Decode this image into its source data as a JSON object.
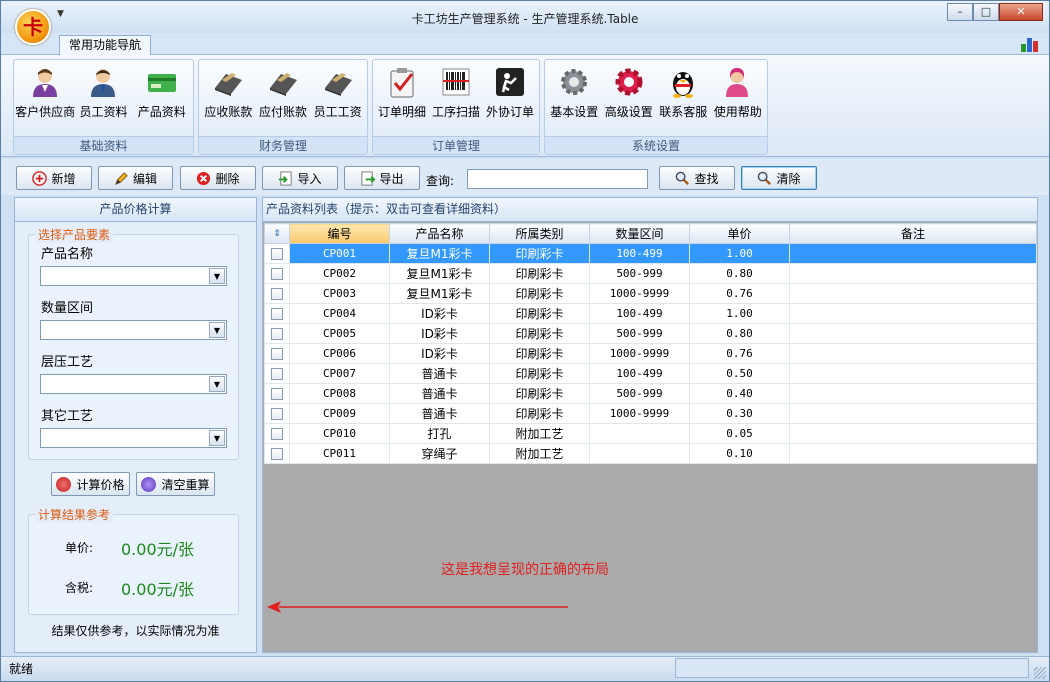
{
  "window": {
    "title": "卡工坊生产管理系统 - 生产管理系统.Table",
    "logo_char": "卡",
    "controls": {
      "minimize": "–",
      "maximize": "□",
      "close": "✕"
    }
  },
  "tabs": [
    {
      "label": "常用功能导航",
      "selected": true
    }
  ],
  "ribbon": {
    "groups": [
      {
        "label": "基础资料",
        "buttons": [
          {
            "label": "客户供应商",
            "icon": "customer-icon"
          },
          {
            "label": "员工资料",
            "icon": "employee-icon"
          },
          {
            "label": "产品资料",
            "icon": "product-card-icon"
          }
        ]
      },
      {
        "label": "财务管理",
        "buttons": [
          {
            "label": "应收账款",
            "icon": "card-reader-icon"
          },
          {
            "label": "应付账款",
            "icon": "card-reader-icon"
          },
          {
            "label": "员工工资",
            "icon": "card-reader-icon"
          }
        ]
      },
      {
        "label": "订单管理",
        "buttons": [
          {
            "label": "订单明细",
            "icon": "clipboard-check-icon"
          },
          {
            "label": "工序扫描",
            "icon": "barcode-icon"
          },
          {
            "label": "外协订单",
            "icon": "worker-icon"
          }
        ]
      },
      {
        "label": "系统设置",
        "buttons": [
          {
            "label": "基本设置",
            "icon": "gear-icon"
          },
          {
            "label": "高级设置",
            "icon": "red-gear-icon"
          },
          {
            "label": "联系客服",
            "icon": "qq-penguin-icon"
          },
          {
            "label": "使用帮助",
            "icon": "help-person-icon"
          }
        ]
      }
    ]
  },
  "toolbar": {
    "add": "新增",
    "edit": "编辑",
    "delete": "删除",
    "import": "导入",
    "export": "导出",
    "query_label": "查询:",
    "query_value": "",
    "search": "查找",
    "clear": "清除"
  },
  "calc_panel": {
    "title": "产品价格计算",
    "section_title": "选择产品要素",
    "fields": [
      {
        "label": "产品名称",
        "value": ""
      },
      {
        "label": "数量区间",
        "value": ""
      },
      {
        "label": "层压工艺",
        "value": ""
      },
      {
        "label": "其它工艺",
        "value": ""
      }
    ],
    "calc_button": "计算价格",
    "reset_button": "清空重算",
    "result_title": "计算结果参考",
    "unit_price_label": "单价:",
    "unit_price_value": "0.00元/张",
    "tax_label": "含税:",
    "tax_value": "0.00元/张",
    "footnote": "结果仅供参考，以实际情况为准"
  },
  "product_list": {
    "title": "产品资料列表（提示：双击可查看详细资料）",
    "columns": [
      "编号",
      "产品名称",
      "所属类别",
      "数量区间",
      "单价",
      "备注"
    ],
    "rows": [
      {
        "code": "CP001",
        "name": "复旦M1彩卡",
        "category": "印刷彩卡",
        "range": "100-499",
        "price": "1.00",
        "note": "",
        "selected": true
      },
      {
        "code": "CP002",
        "name": "复旦M1彩卡",
        "category": "印刷彩卡",
        "range": "500-999",
        "price": "0.80",
        "note": ""
      },
      {
        "code": "CP003",
        "name": "复旦M1彩卡",
        "category": "印刷彩卡",
        "range": "1000-9999",
        "price": "0.76",
        "note": ""
      },
      {
        "code": "CP004",
        "name": "ID彩卡",
        "category": "印刷彩卡",
        "range": "100-499",
        "price": "1.00",
        "note": ""
      },
      {
        "code": "CP005",
        "name": "ID彩卡",
        "category": "印刷彩卡",
        "range": "500-999",
        "price": "0.80",
        "note": ""
      },
      {
        "code": "CP006",
        "name": "ID彩卡",
        "category": "印刷彩卡",
        "range": "1000-9999",
        "price": "0.76",
        "note": ""
      },
      {
        "code": "CP007",
        "name": "普通卡",
        "category": "印刷彩卡",
        "range": "100-499",
        "price": "0.50",
        "note": ""
      },
      {
        "code": "CP008",
        "name": "普通卡",
        "category": "印刷彩卡",
        "range": "500-999",
        "price": "0.40",
        "note": ""
      },
      {
        "code": "CP009",
        "name": "普通卡",
        "category": "印刷彩卡",
        "range": "1000-9999",
        "price": "0.30",
        "note": ""
      },
      {
        "code": "CP010",
        "name": "打孔",
        "category": "附加工艺",
        "range": "",
        "price": "0.05",
        "note": ""
      },
      {
        "code": "CP011",
        "name": "穿绳子",
        "category": "附加工艺",
        "range": "",
        "price": "0.10",
        "note": ""
      }
    ]
  },
  "annotation": "这是我想呈现的正确的布局",
  "status": {
    "text": "就绪"
  },
  "colors": {
    "selection": "#3399ff",
    "result_green": "#1a8a1a",
    "legend_orange": "#e05a10",
    "annotation_red": "#e02020"
  }
}
